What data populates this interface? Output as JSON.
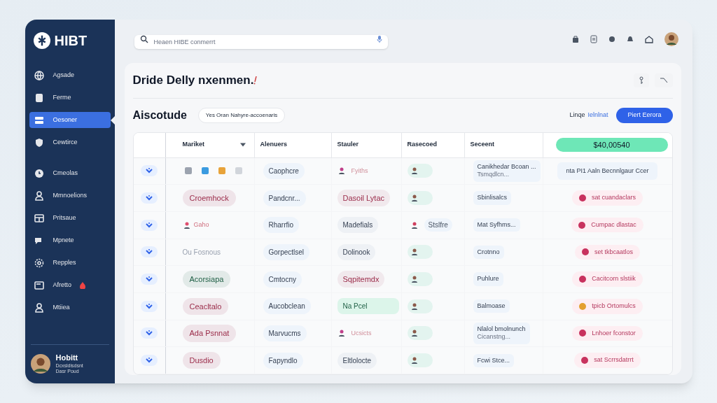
{
  "sidebar": {
    "logo": "HIBT",
    "items": [
      {
        "label": "Agsade",
        "selected": false,
        "alert": false
      },
      {
        "label": "Ferme",
        "selected": false,
        "alert": false
      },
      {
        "label": "Oesoner",
        "selected": true,
        "alert": false
      },
      {
        "label": "Cewtirce",
        "selected": false,
        "alert": false
      },
      {
        "label": "Cmeolas",
        "selected": false,
        "alert": false
      },
      {
        "label": "Mmnoelions",
        "selected": false,
        "alert": false
      },
      {
        "label": "Pritsaue",
        "selected": false,
        "alert": false
      },
      {
        "label": "Mpnete",
        "selected": false,
        "alert": false
      },
      {
        "label": "Repples",
        "selected": false,
        "alert": false
      },
      {
        "label": "Afretto",
        "selected": false,
        "alert": true
      },
      {
        "label": "Mtiiea",
        "selected": false,
        "alert": false
      }
    ],
    "user": {
      "name": "Hobitt",
      "role": "Dcxsldisdsnt",
      "status": "Dasr Poud"
    }
  },
  "search": {
    "placeholder": "Heaen HIBE conmerrt"
  },
  "page": {
    "title": "Dride Delly nxenmen.",
    "subtitle": "Aiscotude",
    "filter_chip": "Yes Oran Nahyre-accoenaris",
    "link_prefix": "Linqe",
    "link": "Ielnlnat",
    "primary_button": "Piert Eerora"
  },
  "table": {
    "columns": [
      {
        "label": "Mariket",
        "sortable": true
      },
      {
        "label": "Alenuers",
        "sortable": false
      },
      {
        "label": "Stauler",
        "sortable": false
      },
      {
        "label": "Rasecoed",
        "sortable": false
      },
      {
        "label": "Seceent",
        "sortable": false
      }
    ],
    "total": "$40,00540",
    "rows": [
      {
        "market": {
          "kind": "icons"
        },
        "alenuers": "Caophcre",
        "stauler": {
          "kind": "icon-text",
          "text": "Fyiths"
        },
        "rasecoed": {
          "kind": "avatar"
        },
        "seceent": [
          "Canikhedar Bcoan ...",
          "Tsmqdlcn..."
        ],
        "status": {
          "kind": "plain",
          "text": "nta PI1 Aaln Becnnlgaur Ccer"
        }
      },
      {
        "market": {
          "kind": "pill",
          "text": "Croemhock",
          "color": "#9b2c4a"
        },
        "alenuers": "Pandcnr...",
        "stauler": {
          "kind": "pill",
          "text": "Dasoil Lytac",
          "color": "#9b2c4a"
        },
        "rasecoed": {
          "kind": "avatar"
        },
        "seceent": [
          "Sbinlisalcs"
        ],
        "status": {
          "kind": "icon",
          "text": "sat cuandaclars",
          "color": "#c8325e"
        }
      },
      {
        "market": {
          "kind": "icon-text",
          "text": "Gaho"
        },
        "alenuers": "Rharrfio",
        "stauler": {
          "kind": "tag",
          "text": "Madefials"
        },
        "rasecoed": {
          "kind": "avatar-text",
          "text": "Stslfre"
        },
        "seceent": [
          "Mat Syfhms..."
        ],
        "status": {
          "kind": "icon",
          "text": "Cumpac dlastac",
          "color": "#c8325e"
        }
      },
      {
        "market": {
          "kind": "plain",
          "text": "Ou Fosnous"
        },
        "alenuers": "Gorpectlsel",
        "stauler": {
          "kind": "tag",
          "text": "Dolinook"
        },
        "rasecoed": {
          "kind": "avatar"
        },
        "seceent": [
          "Crotnno"
        ],
        "status": {
          "kind": "icon",
          "text": "set tkbcaatlos",
          "color": "#c8325e"
        }
      },
      {
        "market": {
          "kind": "pill",
          "text": "Acorsiapa",
          "color": "#1f5f45"
        },
        "alenuers": "Cmtocny",
        "stauler": {
          "kind": "pill",
          "text": "Sqpitemdx",
          "color": "#9b2c4a"
        },
        "rasecoed": {
          "kind": "avatar"
        },
        "seceent": [
          "Puhlure"
        ],
        "status": {
          "kind": "icon",
          "text": "Cacitcorn slstiik",
          "color": "#c8325e"
        }
      },
      {
        "market": {
          "kind": "pill",
          "text": "Ceacltalo",
          "color": "#9b2c4a"
        },
        "alenuers": "Aucobclean",
        "stauler": {
          "kind": "wide-pill",
          "text": "Na Pcel",
          "color": "#1f5f45"
        },
        "rasecoed": {
          "kind": "avatar"
        },
        "seceent": [
          "Balmoase"
        ],
        "status": {
          "kind": "icon",
          "text": "tpicb Ortomulcs",
          "color": "#e3a02f"
        }
      },
      {
        "market": {
          "kind": "pill",
          "text": "Ada Psnnat",
          "color": "#9b2c4a"
        },
        "alenuers": "Marvucms",
        "stauler": {
          "kind": "icon-text",
          "text": "Ucsicts"
        },
        "rasecoed": {
          "kind": "avatar"
        },
        "seceent": [
          "Nlalol bmolnunch",
          "Cicanstng..."
        ],
        "status": {
          "kind": "icon",
          "text": "Lnhoer fconstor",
          "color": "#c8325e"
        }
      },
      {
        "market": {
          "kind": "pill",
          "text": "Dusdio",
          "color": "#9b2c4a"
        },
        "alenuers": "Fapyndlo",
        "stauler": {
          "kind": "tag",
          "text": "Eltlolocte"
        },
        "rasecoed": {
          "kind": "avatar"
        },
        "seceent": [
          "Fcwi Stce..."
        ],
        "status": {
          "kind": "icon",
          "text": "sat Scrrsdatrrt",
          "color": "#c8325e"
        }
      }
    ]
  }
}
